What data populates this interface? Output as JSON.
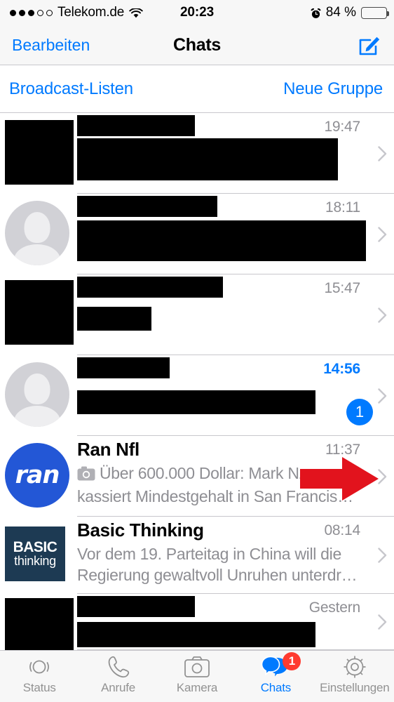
{
  "status_bar": {
    "signal_dots_filled": 3,
    "signal_dots_empty": 2,
    "carrier": "Telekom.de",
    "wifi_icon": "wifi-icon",
    "time": "20:23",
    "alarm_icon": "alarm-clock-icon",
    "battery_percent": "84 %",
    "battery_level": 84,
    "battery_color": "#f5c518"
  },
  "nav_bar": {
    "left_label": "Bearbeiten",
    "title": "Chats",
    "compose_icon": "compose-pencil-icon"
  },
  "broadcast_bar": {
    "left_label": "Broadcast-Listen",
    "right_label": "Neue Gruppe"
  },
  "colors": {
    "accent_blue": "#007aff",
    "badge_red": "#ff3b30",
    "arrow_red": "#e2131d",
    "ran_blue": "#2357d6",
    "basic_thinking_navy": "#1d3a53",
    "muted_gray": "#8e8e93"
  },
  "chats": [
    {
      "avatar_type": "redacted",
      "title": "",
      "title_redacted": true,
      "preview": "",
      "preview_redacted": true,
      "preview_lines": 2,
      "time": "19:47",
      "unread": false,
      "badge": null,
      "has_camera_icon": false
    },
    {
      "avatar_type": "default-person",
      "title": "",
      "title_redacted": true,
      "preview": "",
      "preview_redacted": true,
      "preview_lines": 2,
      "time": "18:11",
      "unread": false,
      "badge": null,
      "has_camera_icon": false
    },
    {
      "avatar_type": "redacted",
      "title": "",
      "title_redacted": true,
      "preview": "",
      "preview_redacted": true,
      "preview_lines": 1,
      "time": "15:47",
      "unread": false,
      "badge": null,
      "has_camera_icon": false
    },
    {
      "avatar_type": "default-person",
      "title": "",
      "title_redacted": true,
      "preview": "",
      "preview_redacted": true,
      "preview_lines": 1,
      "time": "14:56",
      "unread": true,
      "badge": "1",
      "has_camera_icon": false
    },
    {
      "avatar_type": "logo-ran",
      "avatar_logo_text": "ran",
      "title": "Ran Nfl",
      "title_redacted": false,
      "preview": "Über 600.000 Dollar: Mark Nz kassiert Mindestgehalt in San Francis…",
      "preview_redacted": false,
      "preview_lines": 2,
      "time": "11:37",
      "unread": false,
      "badge": null,
      "has_camera_icon": true,
      "camera_icon": "camera-icon"
    },
    {
      "avatar_type": "logo-basic-thinking",
      "avatar_logo_line1": "BASIC",
      "avatar_logo_line2": "thinking",
      "title": "Basic Thinking",
      "title_redacted": false,
      "preview": "Vor dem 19. Parteitag in China will die Regierung gewaltvoll Unruhen unterdr…",
      "preview_redacted": false,
      "preview_lines": 2,
      "time": "08:14",
      "unread": false,
      "badge": null,
      "has_camera_icon": false
    },
    {
      "avatar_type": "redacted",
      "title": "",
      "title_redacted": true,
      "preview": "",
      "preview_redacted": true,
      "preview_lines": 1,
      "time": "Gestern",
      "unread": false,
      "badge": null,
      "has_camera_icon": false
    }
  ],
  "annotation": {
    "type": "red-arrow",
    "direction": "right",
    "points_at_row": "Ran Nfl",
    "color": "#e2131d"
  },
  "tab_bar": {
    "tabs": [
      {
        "label": "Status",
        "icon": "status-rings-icon",
        "active": false,
        "badge": null
      },
      {
        "label": "Anrufe",
        "icon": "phone-icon",
        "active": false,
        "badge": null
      },
      {
        "label": "Kamera",
        "icon": "camera-icon",
        "active": false,
        "badge": null
      },
      {
        "label": "Chats",
        "icon": "chat-bubbles-icon",
        "active": true,
        "badge": "1"
      },
      {
        "label": "Einstellungen",
        "icon": "gear-icon",
        "active": false,
        "badge": null
      }
    ]
  }
}
